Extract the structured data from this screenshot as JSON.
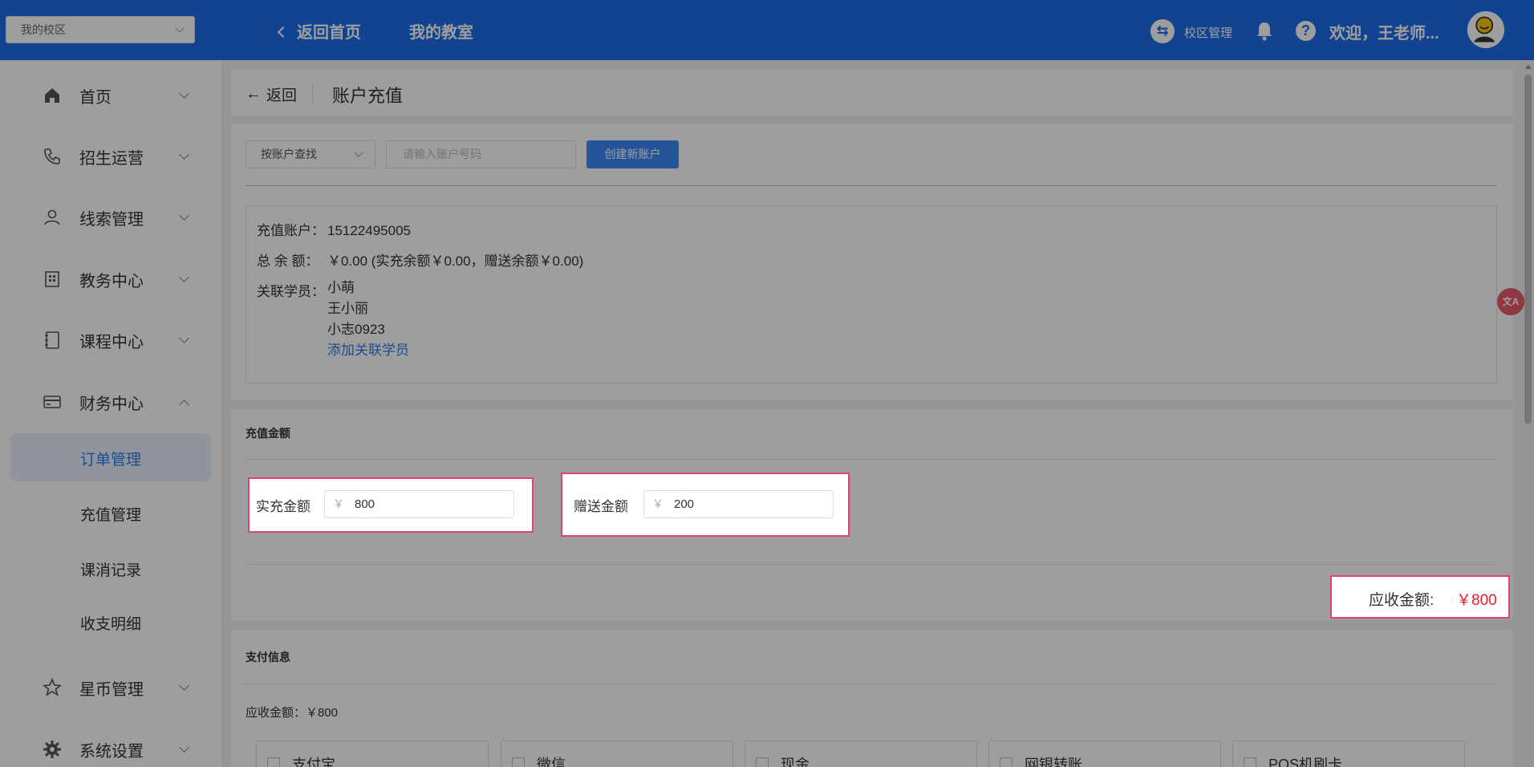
{
  "header": {
    "campus_select": "我的校区",
    "back_home": "返回首页",
    "my_classroom": "我的教室",
    "campus_manage": "校区管理",
    "welcome": "欢迎，王老师...",
    "help_icon": "?"
  },
  "sidebar": {
    "items": [
      {
        "label": "首页",
        "icon": "home-icon"
      },
      {
        "label": "招生运营",
        "icon": "phone-icon"
      },
      {
        "label": "线索管理",
        "icon": "user-icon"
      },
      {
        "label": "教务中心",
        "icon": "building-icon"
      },
      {
        "label": "课程中心",
        "icon": "notebook-icon"
      },
      {
        "label": "财务中心",
        "icon": "card-icon"
      },
      {
        "label": "星币管理",
        "icon": "star-icon"
      },
      {
        "label": "系统设置",
        "icon": "gear-icon"
      }
    ],
    "finance_sub": [
      {
        "label": "订单管理",
        "active": true
      },
      {
        "label": "充值管理",
        "active": false
      },
      {
        "label": "课消记录",
        "active": false
      },
      {
        "label": "收支明细",
        "active": false
      }
    ]
  },
  "topbar": {
    "back": "返回",
    "title": "账户充值"
  },
  "search": {
    "type": "按账户查找",
    "placeholder": "请输入账户号码",
    "create_btn": "创建新账户"
  },
  "account": {
    "account_label": "充值账户：",
    "account_value": "15122495005",
    "balance_label": "总 余 额：",
    "balance_value": "￥0.00 (实充余额￥0.00，赠送余额￥0.00)",
    "students_label": "关联学员：",
    "students": [
      "小萌",
      "王小丽",
      "小志0923"
    ],
    "add_student": "添加关联学员"
  },
  "recharge": {
    "section_title": "充值金额",
    "actual_label": "实充金额",
    "actual_currency": "￥",
    "actual_value": "800",
    "gift_label": "赠送金额",
    "gift_currency": "￥",
    "gift_value": "200",
    "receivable_label": "应收金额:",
    "receivable_value": "￥800"
  },
  "payment": {
    "section_title": "支付信息",
    "amount_text": "应收金额：￥800",
    "options": [
      "支付宝",
      "微信",
      "现金",
      "网银转账",
      "POS机刷卡"
    ]
  },
  "colors": {
    "primary": "#1d6ce8",
    "highlight_border": "#e0407b",
    "amount_red": "#e0202b",
    "link_blue": "#2f7be6"
  }
}
